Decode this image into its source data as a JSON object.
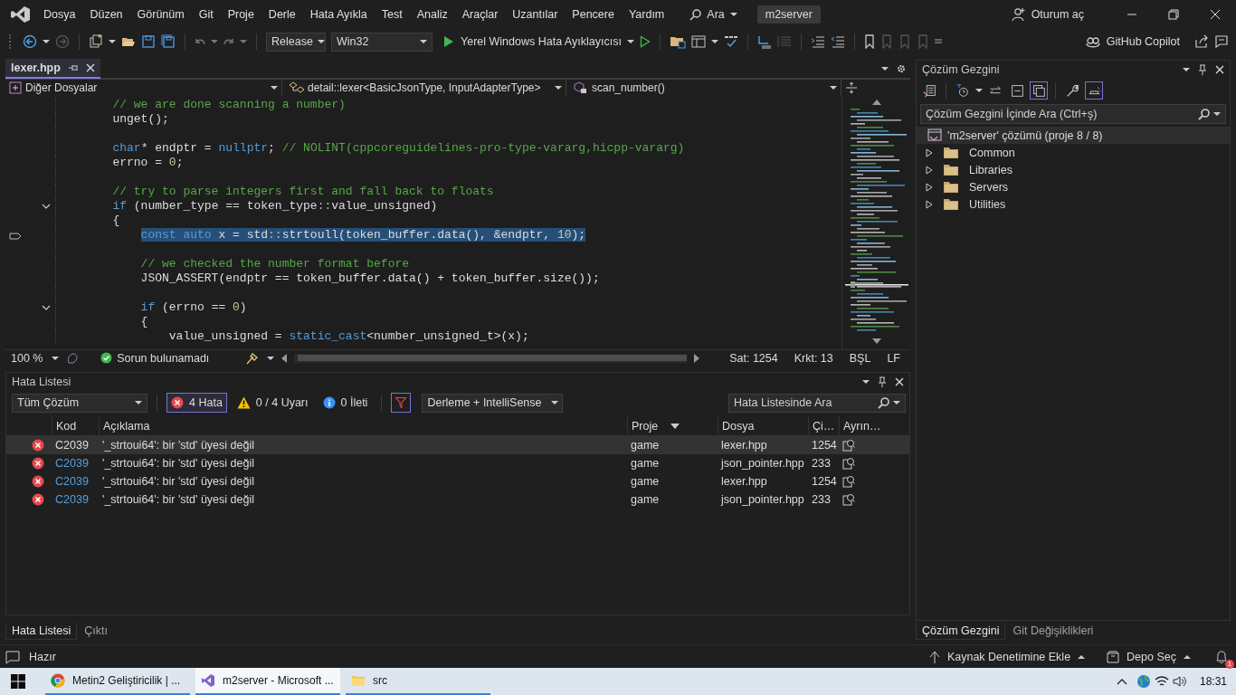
{
  "title_bar": {
    "menu": [
      "Dosya",
      "Düzen",
      "Görünüm",
      "Git",
      "Proje",
      "Derle",
      "Hata Ayıkla",
      "Test",
      "Analiz",
      "Araçlar",
      "Uzantılar",
      "Pencere",
      "Yardım"
    ],
    "search": "Ara",
    "solution": "m2server",
    "sign_in": "Oturum aç"
  },
  "toolbar": {
    "configuration": "Release",
    "platform": "Win32",
    "start": "Yerel Windows Hata Ayıklayıcısı",
    "copilot": "GitHub Copilot"
  },
  "editor": {
    "tabs": [
      {
        "label": "lexer.hpp",
        "selected": true
      }
    ],
    "navigation": {
      "project": "Diğer Dosyalar",
      "scope": "detail::lexer<BasicJsonType, InputAdapterType>",
      "member": "scan_number()"
    },
    "lines": [
      {
        "kind": "code",
        "segments": [
          {
            "kind": "cmt",
            "text": "// we are done scanning a number)"
          }
        ]
      },
      {
        "kind": "code",
        "segments": [
          {
            "kind": "txt",
            "text": "unget();"
          }
        ]
      },
      {
        "kind": "blank"
      },
      {
        "kind": "code",
        "segments": [
          {
            "kind": "kw",
            "text": "char"
          },
          {
            "kind": "txt",
            "text": "* endptr = "
          },
          {
            "kind": "kw",
            "text": "nullptr"
          },
          {
            "kind": "txt",
            "text": "; "
          },
          {
            "kind": "cmt",
            "text": "// NOLINT(cppcoreguidelines-pro-type-vararg,hicpp-vararg)"
          }
        ]
      },
      {
        "kind": "code",
        "segments": [
          {
            "kind": "txt",
            "text": "errno = "
          },
          {
            "kind": "num",
            "text": "0"
          },
          {
            "kind": "txt",
            "text": ";"
          }
        ]
      },
      {
        "kind": "blank"
      },
      {
        "kind": "code",
        "segments": [
          {
            "kind": "cmt",
            "text": "// try to parse integers first and fall back to floats"
          }
        ]
      },
      {
        "kind": "code",
        "foldable": true,
        "segments": [
          {
            "kind": "kw",
            "text": "if"
          },
          {
            "kind": "txt",
            "text": " (number_type == token_type"
          },
          {
            "kind": "op",
            "text": "::"
          },
          {
            "kind": "txt",
            "text": "value_unsigned)"
          }
        ]
      },
      {
        "kind": "code",
        "segments": [
          {
            "kind": "txt",
            "text": "{"
          }
        ]
      },
      {
        "kind": "block",
        "children": [
          {
            "kind": "code",
            "selected": true,
            "segments": [
              {
                "kind": "kw",
                "text": "const auto"
              },
              {
                "kind": "txt",
                "text": " x = std"
              },
              {
                "kind": "op",
                "text": "::"
              },
              {
                "kind": "txt",
                "text": "strtoull(token_buffer.data(), &endptr, "
              },
              {
                "kind": "num",
                "text": "10"
              },
              {
                "kind": "txt",
                "text": ");"
              }
            ]
          },
          {
            "kind": "blank"
          },
          {
            "kind": "code",
            "segments": [
              {
                "kind": "cmt",
                "text": "// we checked the number format before"
              }
            ]
          },
          {
            "kind": "code",
            "segments": [
              {
                "kind": "txt",
                "text": "JSON_ASSERT(endptr == token_buffer.data() + token_buffer.size());"
              }
            ]
          },
          {
            "kind": "blank"
          },
          {
            "kind": "code",
            "foldable": true,
            "segments": [
              {
                "kind": "kw",
                "text": "if"
              },
              {
                "kind": "txt",
                "text": " (errno == "
              },
              {
                "kind": "num",
                "text": "0"
              },
              {
                "kind": "txt",
                "text": ")"
              }
            ]
          },
          {
            "kind": "code",
            "segments": [
              {
                "kind": "txt",
                "text": "{"
              }
            ]
          },
          {
            "kind": "block",
            "children": [
              {
                "kind": "code",
                "segments": [
                  {
                    "kind": "txt",
                    "text": "value_unsigned = "
                  },
                  {
                    "kind": "kw",
                    "text": "static_cast"
                  },
                  {
                    "kind": "txt",
                    "text": "<number_unsigned_t>(x);"
                  }
                ]
              }
            ]
          }
        ]
      }
    ],
    "status": {
      "zoom": "100 %",
      "issues": "Sorun bulunamadı",
      "line": "Sat: 1254",
      "column": "Krkt: 13",
      "encoding": "BŞL",
      "line_ending": "LF"
    }
  },
  "error_list": {
    "title": "Hata Listesi",
    "scope": "Tüm Çözüm",
    "filters": [
      {
        "kind": "error",
        "label": "4 Hata",
        "selected": true
      },
      {
        "kind": "warning",
        "label": "0 / 4 Uyarı",
        "selected": false
      },
      {
        "kind": "message",
        "label": "0 İleti",
        "selected": false
      }
    ],
    "filter_toggle": {
      "selected": true
    },
    "source": "Derleme + IntelliSense",
    "search": {
      "placeholder": "Hata Listesinde Ara"
    },
    "columns": [
      {
        "label": "Kod"
      },
      {
        "label": "Açıklama"
      },
      {
        "label": "Proje",
        "sorted": true
      },
      {
        "label": "Dosya"
      },
      {
        "label": "Çi…"
      },
      {
        "label": "Ayrın…"
      }
    ],
    "rows": [
      {
        "kind": "error",
        "code": "C2039",
        "description": "'_strtoui64': bir 'std' üyesi değil",
        "project": "game",
        "file": "lexer.hpp",
        "line": "1254",
        "selected": true
      },
      {
        "kind": "error",
        "code": "C2039",
        "description": "'_strtoui64': bir 'std' üyesi değil",
        "project": "game",
        "file": "json_pointer.hpp",
        "line": "233",
        "selected": false
      },
      {
        "kind": "error",
        "code": "C2039",
        "description": "'_strtoui64': bir 'std' üyesi değil",
        "project": "game",
        "file": "lexer.hpp",
        "line": "1254",
        "selected": false
      },
      {
        "kind": "error",
        "code": "C2039",
        "description": "'_strtoui64': bir 'std' üyesi değil",
        "project": "game",
        "file": "json_pointer.hpp",
        "line": "233",
        "selected": false
      }
    ],
    "tabs": [
      {
        "label": "Hata Listesi",
        "selected": true
      },
      {
        "label": "Çıktı",
        "selected": false
      }
    ]
  },
  "solution_explorer": {
    "title": "Çözüm Gezgini",
    "tools": [
      {
        "kind": "home",
        "selected": false
      },
      {
        "kind": "history",
        "selected": false
      },
      {
        "kind": "sync",
        "selected": false
      },
      {
        "kind": "collapse",
        "selected": false
      },
      {
        "kind": "show_all",
        "selected": true
      },
      {
        "kind": "properties",
        "selected": false
      },
      {
        "kind": "preview",
        "selected": true
      }
    ],
    "search": {
      "placeholder": "Çözüm Gezgini İçinde Ara (Ctrl+ş)"
    },
    "tree": [
      {
        "kind": "solution",
        "label": "'m2server' çözümü (proje 8 / 8)",
        "selected": true,
        "children": [
          {
            "kind": "folder",
            "label": "Common",
            "expanded": false,
            "selected": false
          },
          {
            "kind": "folder",
            "label": "Libraries",
            "expanded": false,
            "selected": false
          },
          {
            "kind": "folder",
            "label": "Servers",
            "expanded": false,
            "selected": false
          },
          {
            "kind": "folder",
            "label": "Utilities",
            "expanded": false,
            "selected": false
          }
        ]
      }
    ],
    "tabs": [
      {
        "label": "Çözüm Gezgini",
        "selected": true
      },
      {
        "label": "Git Değişiklikleri",
        "selected": false
      }
    ]
  },
  "status_bar": {
    "message": "Hazır",
    "source_control": "Kaynak Denetimine Ekle",
    "repository": "Depo Seç",
    "notifications": "1"
  },
  "taskbar": {
    "items": [
      {
        "kind": "browser",
        "label": "Metin2 Geliştiricilik | ...",
        "selected": false
      },
      {
        "kind": "ide",
        "label": "m2server - Microsoft ...",
        "selected": true
      },
      {
        "kind": "folder",
        "label": "src",
        "selected": false
      }
    ],
    "clock": "18:31"
  }
}
